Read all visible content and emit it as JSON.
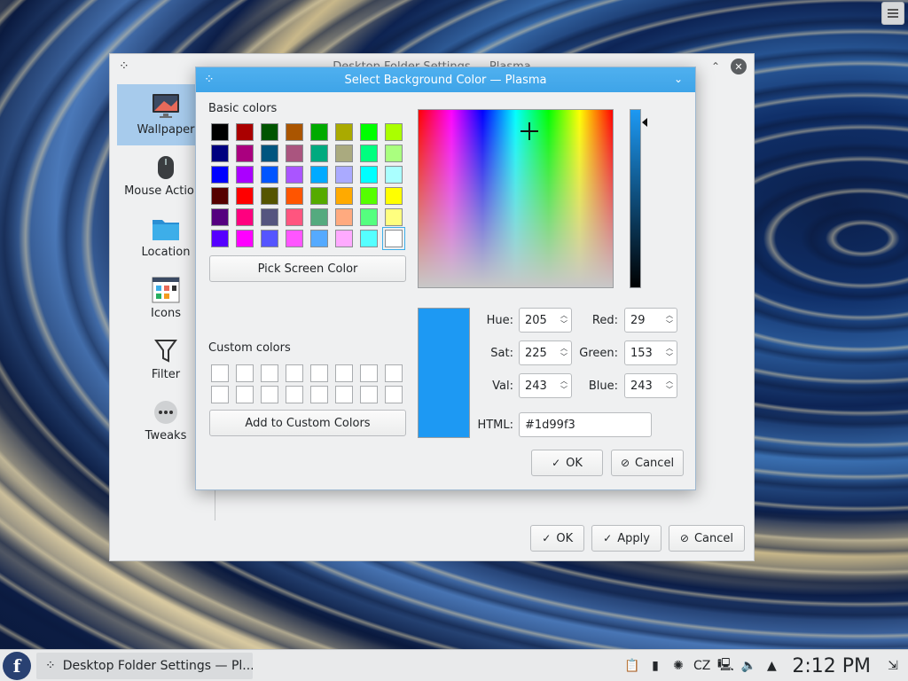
{
  "back_window": {
    "title": "Desktop Folder Settings — Plasma",
    "sidebar": [
      {
        "label": "Wallpaper",
        "icon": "monitor-icon",
        "active": true
      },
      {
        "label": "Mouse Actions",
        "icon": "mouse-icon",
        "active": false
      },
      {
        "label": "Location",
        "icon": "folder-icon",
        "active": false
      },
      {
        "label": "Icons",
        "icon": "icons-grid-icon",
        "active": false
      },
      {
        "label": "Filter",
        "icon": "filter-icon",
        "active": false
      },
      {
        "label": "Tweaks",
        "icon": "more-icon",
        "active": false
      }
    ],
    "buttons": {
      "ok": "OK",
      "apply": "Apply",
      "cancel": "Cancel"
    }
  },
  "dialog": {
    "title": "Select Background Color — Plasma",
    "basic_colors_label": "Basic colors",
    "basic_colors": [
      "#000000",
      "#aa0000",
      "#005500",
      "#aa5500",
      "#00aa00",
      "#aaaa00",
      "#00ff00",
      "#aaff00",
      "#00007f",
      "#aa007f",
      "#00557f",
      "#aa557f",
      "#00aa7f",
      "#aaaa7f",
      "#00ff7f",
      "#aaff7f",
      "#0000ff",
      "#aa00ff",
      "#0055ff",
      "#aa55ff",
      "#00aaff",
      "#aaaaff",
      "#00ffff",
      "#aaffff",
      "#550000",
      "#ff0000",
      "#555500",
      "#ff5500",
      "#55aa00",
      "#ffaa00",
      "#55ff00",
      "#ffff00",
      "#55007f",
      "#ff007f",
      "#55557f",
      "#ff557f",
      "#55aa7f",
      "#ffaa7f",
      "#55ff7f",
      "#ffff7f",
      "#5500ff",
      "#ff00ff",
      "#5555ff",
      "#ff55ff",
      "#55aaff",
      "#ffaaff",
      "#55ffff",
      "#ffffff"
    ],
    "selected_basic_index": 47,
    "pick_screen_label": "Pick Screen Color",
    "custom_colors_label": "Custom colors",
    "custom_colors_count": 16,
    "add_custom_label": "Add to Custom Colors",
    "current_color": "#1d99f3",
    "picker_hue": 205,
    "picker_sat": 225,
    "value_level": 243,
    "fields": {
      "hue_label": "Hue:",
      "hue": "205",
      "sat_label": "Sat:",
      "sat": "225",
      "val_label": "Val:",
      "val": "243",
      "red_label": "Red:",
      "red": "29",
      "green_label": "Green:",
      "green": "153",
      "blue_label": "Blue:",
      "blue": "243",
      "html_label": "HTML:",
      "html": "#1d99f3"
    },
    "ok_label": "OK",
    "cancel_label": "Cancel"
  },
  "taskbar": {
    "launcher_icon": "fedora-icon",
    "task_label": "Desktop Folder Settings — Pl...",
    "keyboard_layout": "CZ",
    "clock": "2:12 PM"
  }
}
